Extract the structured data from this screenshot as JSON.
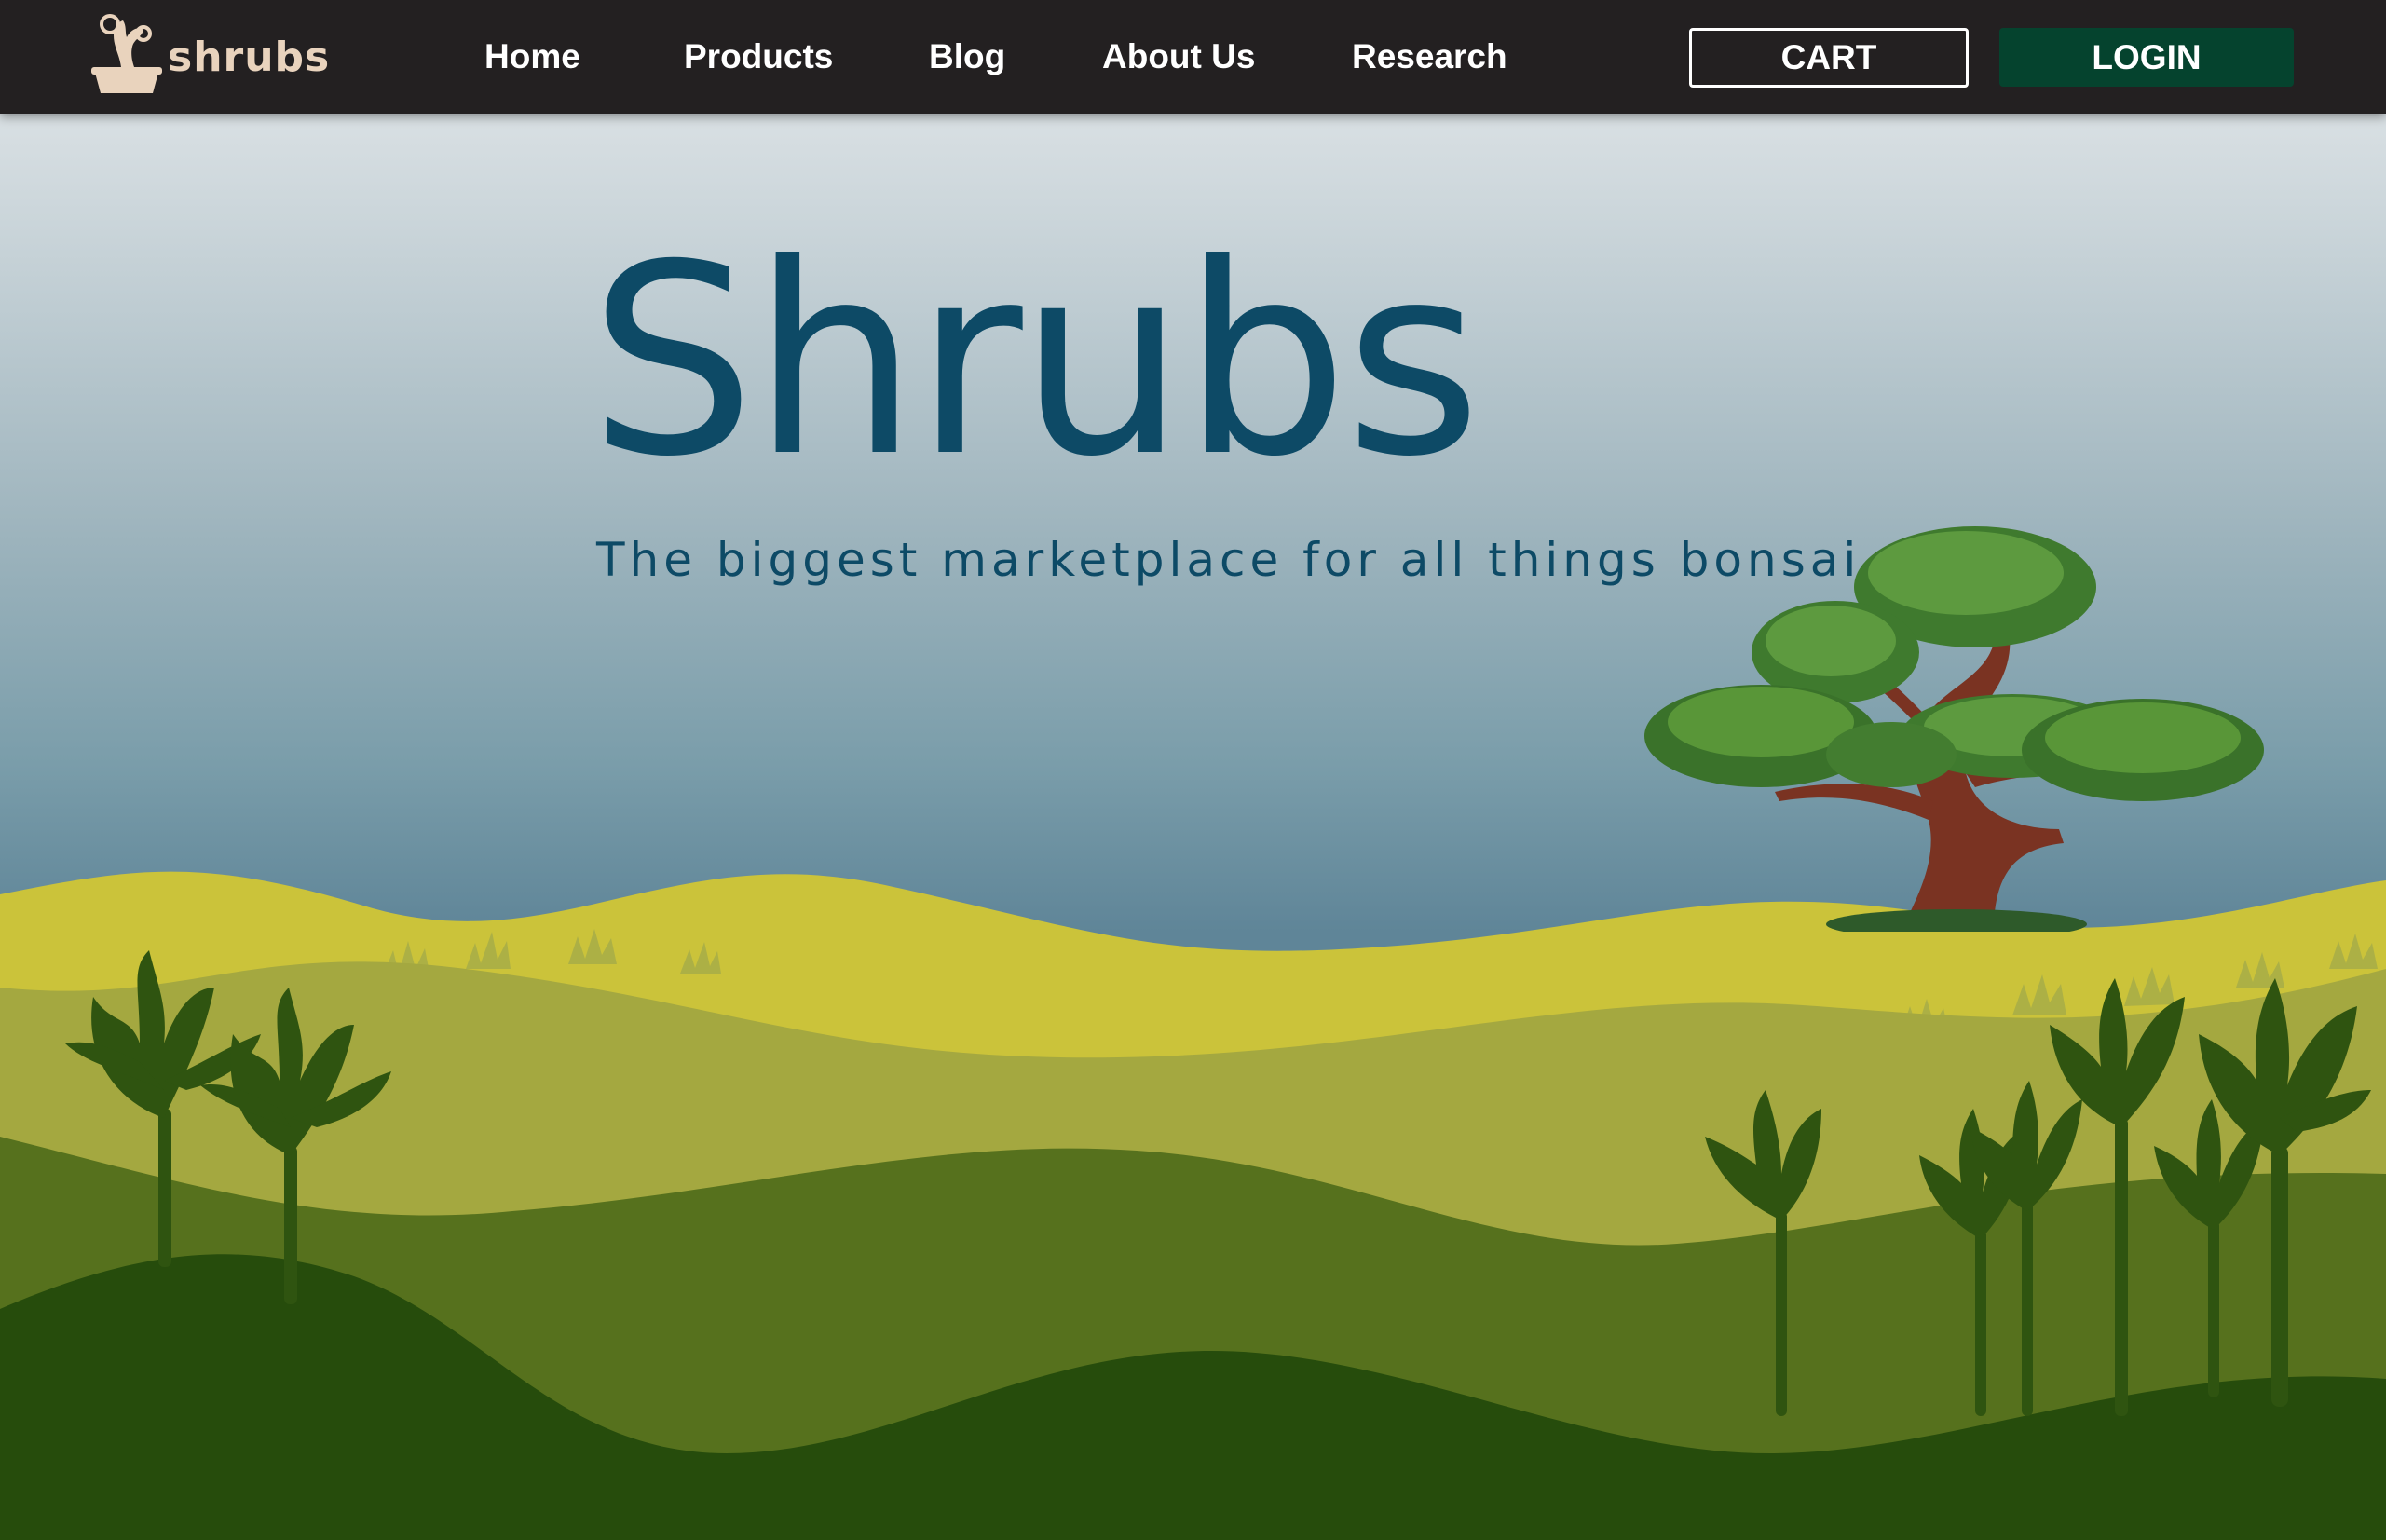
{
  "site": {
    "logo_text": "shrubs",
    "logo_icon": "bonsai-pot-logo-icon"
  },
  "nav": {
    "items": [
      {
        "label": "Home"
      },
      {
        "label": "Products"
      },
      {
        "label": "Blog"
      },
      {
        "label": "About Us"
      },
      {
        "label": "Research"
      }
    ],
    "cart_label": "CART",
    "login_label": "LOGIN"
  },
  "hero": {
    "title": "Shrubs",
    "subtitle": "The biggest marketplace for all things bonsai"
  },
  "colors": {
    "navbar_bg": "#232021",
    "logo_text": "#e9d3bd",
    "login_bg": "#05432e",
    "title": "#0d4a66",
    "hill_yellow": "#cbc33a",
    "hill_olive": "#a4a840",
    "hill_green": "#56711d",
    "hill_dark": "#264c0c"
  }
}
